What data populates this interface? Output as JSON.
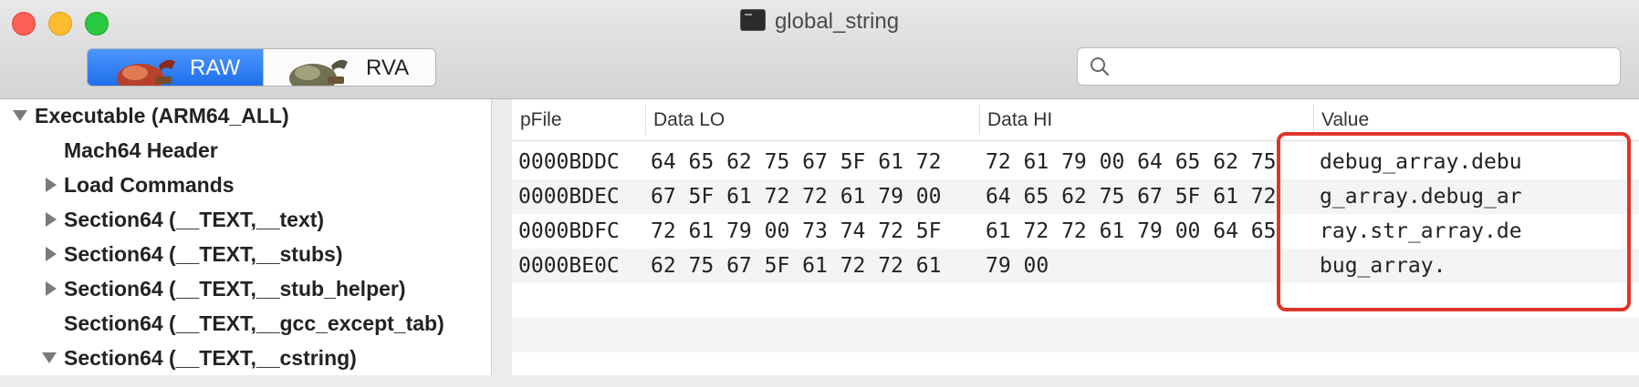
{
  "window": {
    "title": "global_string"
  },
  "toolbar": {
    "raw_label": "RAW",
    "rva_label": "RVA",
    "search": {
      "value": "",
      "placeholder": ""
    }
  },
  "sidebar": {
    "items": [
      {
        "label": "Executable  (ARM64_ALL)",
        "disclosure": "expanded"
      },
      {
        "label": "Mach64 Header",
        "disclosure": "none"
      },
      {
        "label": "Load Commands",
        "disclosure": "collapsed"
      },
      {
        "label": "Section64 (__TEXT,__text)",
        "disclosure": "collapsed"
      },
      {
        "label": "Section64 (__TEXT,__stubs)",
        "disclosure": "collapsed"
      },
      {
        "label": "Section64 (__TEXT,__stub_helper)",
        "disclosure": "collapsed"
      },
      {
        "label": "Section64 (__TEXT,__gcc_except_tab)",
        "disclosure": "none"
      },
      {
        "label": "Section64 (__TEXT,__cstring)",
        "disclosure": "expanded"
      }
    ]
  },
  "table": {
    "columns": [
      "pFile",
      "Data LO",
      "Data HI",
      "Value"
    ],
    "rows": [
      {
        "pfile": "0000BDDC",
        "data_lo": "64 65 62 75 67 5F 61 72",
        "data_hi": "72 61 79 00 64 65 62 75",
        "value": "debug_array.debu"
      },
      {
        "pfile": "0000BDEC",
        "data_lo": "67 5F 61 72 72 61 79 00",
        "data_hi": "64 65 62 75 67 5F 61 72",
        "value": "g_array.debug_ar"
      },
      {
        "pfile": "0000BDFC",
        "data_lo": "72 61 79 00 73 74 72 5F",
        "data_hi": "61 72 72 61 79 00 64 65",
        "value": "ray.str_array.de"
      },
      {
        "pfile": "0000BE0C",
        "data_lo": "62 75 67 5F 61 72 72 61",
        "data_hi": "79 00",
        "value": "bug_array."
      }
    ]
  },
  "annotation": {
    "color": "#e0352a"
  },
  "colors": {
    "selected_segment": "#2a7af0"
  }
}
